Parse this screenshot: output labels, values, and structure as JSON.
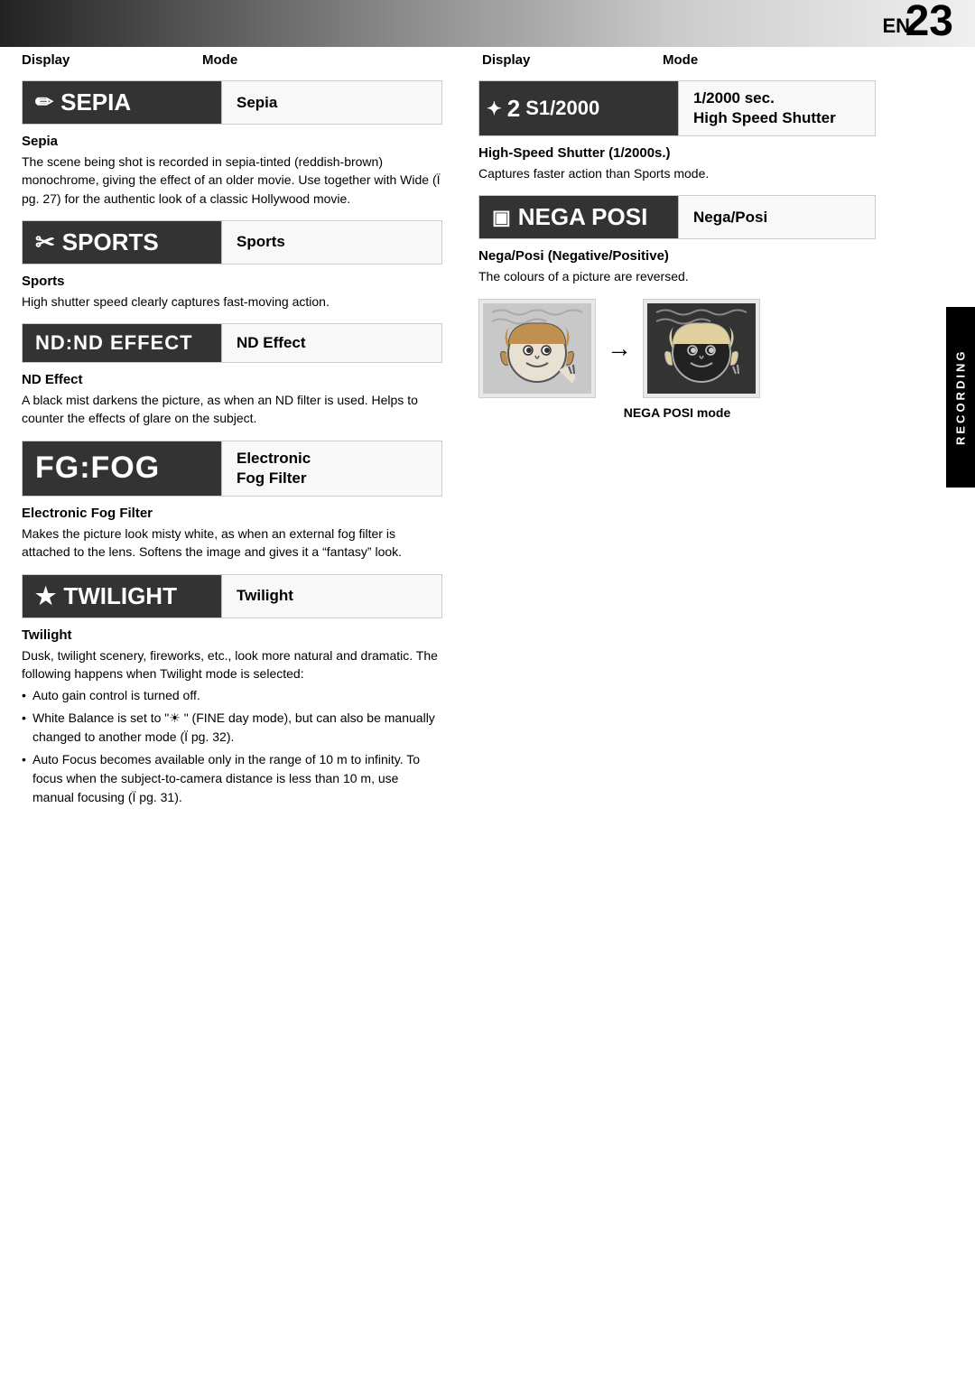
{
  "page": {
    "en_label": "EN",
    "page_number": "23",
    "side_label": "RECORDING"
  },
  "columns": {
    "display": "Display",
    "mode": "Mode"
  },
  "sepia": {
    "display_text": "SEPIA",
    "icon": "✎",
    "mode_label": "Sepia",
    "title": "Sepia",
    "body": "The scene being shot is recorded in sepia-tinted (reddish-brown) monochrome, giving the effect of an older movie. Use together with Wide (Ï pg. 27) for the authentic look of a classic Hollywood movie."
  },
  "sports": {
    "display_text": "SPORTS",
    "icon": "✦",
    "mode_label": "Sports",
    "title": "Sports",
    "body": "High shutter speed clearly captures fast-moving action."
  },
  "nd_effect": {
    "display_text": "ND:ND EFFECT",
    "mode_label": "ND Effect",
    "title": "ND Effect",
    "body": "A black mist darkens the picture, as when an ND filter is used. Helps to counter the effects of glare on the subject."
  },
  "fog": {
    "display_text": "FG:FOG",
    "mode_label_line1": "Electronic",
    "mode_label_line2": "Fog Filter",
    "title": "Electronic Fog Filter",
    "body": "Makes the picture look misty white, as when an external fog filter is attached to the lens. Softens the image and gives it a “fantasy” look."
  },
  "twilight": {
    "display_text": "TWILIGHT",
    "icon": "★",
    "mode_label": "Twilight",
    "title": "Twilight",
    "body": "Dusk, twilight scenery, fireworks, etc., look more natural and dramatic. The following happens when Twilight mode is selected:",
    "bullets": [
      "Auto gain control is turned off.",
      "White Balance is set to \"☀ \" (FINE day mode), but can also be manually changed to another mode (Ï pg. 32).",
      "Auto Focus becomes available only in the range of 10 m to infinity. To focus when the subject-to-camera distance is less than 10 m, use manual focusing (Ï pg. 31)."
    ]
  },
  "high_speed": {
    "display_icon": "✦",
    "display_num": "2",
    "display_text": "S1/2000",
    "mode_label_line1": "1/2000 sec.",
    "mode_label_line2": "High Speed Shutter",
    "title": "High-Speed Shutter (1/2000s.)",
    "body": "Captures faster action than Sports mode."
  },
  "nega_posi": {
    "display_text": "NEGA POSI",
    "icon": "▣",
    "mode_label": "Nega/Posi",
    "title": "Nega/Posi (Negative/Positive)",
    "body": "The colours of a picture are reversed.",
    "caption": "NEGA POSI mode"
  }
}
